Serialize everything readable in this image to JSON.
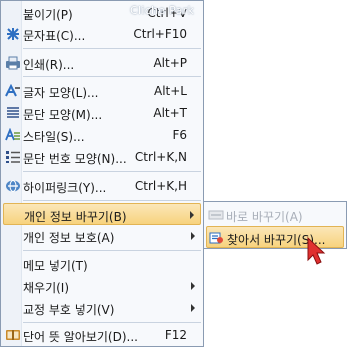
{
  "watermark": "Cliche Park",
  "menu": {
    "items": [
      {
        "label": "붙이기(P)",
        "shortcut": "Ctrl+V",
        "icon": "paste-icon"
      },
      {
        "label": "문자표(C)...",
        "shortcut": "Ctrl+F10",
        "icon": "character-map-icon"
      },
      {
        "label": "인쇄(R)...",
        "shortcut": "Alt+P",
        "icon": "print-icon"
      },
      {
        "label": "글자 모양(L)...",
        "shortcut": "Alt+L",
        "icon": "char-shape-icon"
      },
      {
        "label": "문단 모양(M)...",
        "shortcut": "Alt+T",
        "icon": "paragraph-shape-icon"
      },
      {
        "label": "스타일(S)...",
        "shortcut": "F6",
        "icon": "style-icon"
      },
      {
        "label": "문단 번호 모양(N)...",
        "shortcut": "Ctrl+K,N",
        "icon": "paragraph-number-icon"
      },
      {
        "label": "하이퍼링크(Y)...",
        "shortcut": "Ctrl+K,H",
        "icon": "hyperlink-icon"
      },
      {
        "label": "개인 정보 바꾸기(B)",
        "shortcut": "",
        "icon": ""
      },
      {
        "label": "개인 정보 보호(A)",
        "shortcut": "",
        "icon": ""
      },
      {
        "label": "메모 넣기(T)",
        "shortcut": "",
        "icon": ""
      },
      {
        "label": "채우기(I)",
        "shortcut": "",
        "icon": ""
      },
      {
        "label": "교정 부호 넣기(V)",
        "shortcut": "",
        "icon": ""
      },
      {
        "label": "단어 뜻 알아보기(D)...",
        "shortcut": "F12",
        "icon": "dictionary-icon"
      }
    ]
  },
  "submenu": {
    "items": [
      {
        "label": "바로 바꾸기(A)",
        "enabled": false,
        "icon": "replace-now-icon"
      },
      {
        "label": "찾아서 바꾸기(S)...",
        "enabled": true,
        "icon": "find-replace-icon"
      }
    ]
  },
  "colors": {
    "highlight": "#f7d37e",
    "border": "#8a9bb2",
    "menu_bg": "#f7f9fc"
  }
}
